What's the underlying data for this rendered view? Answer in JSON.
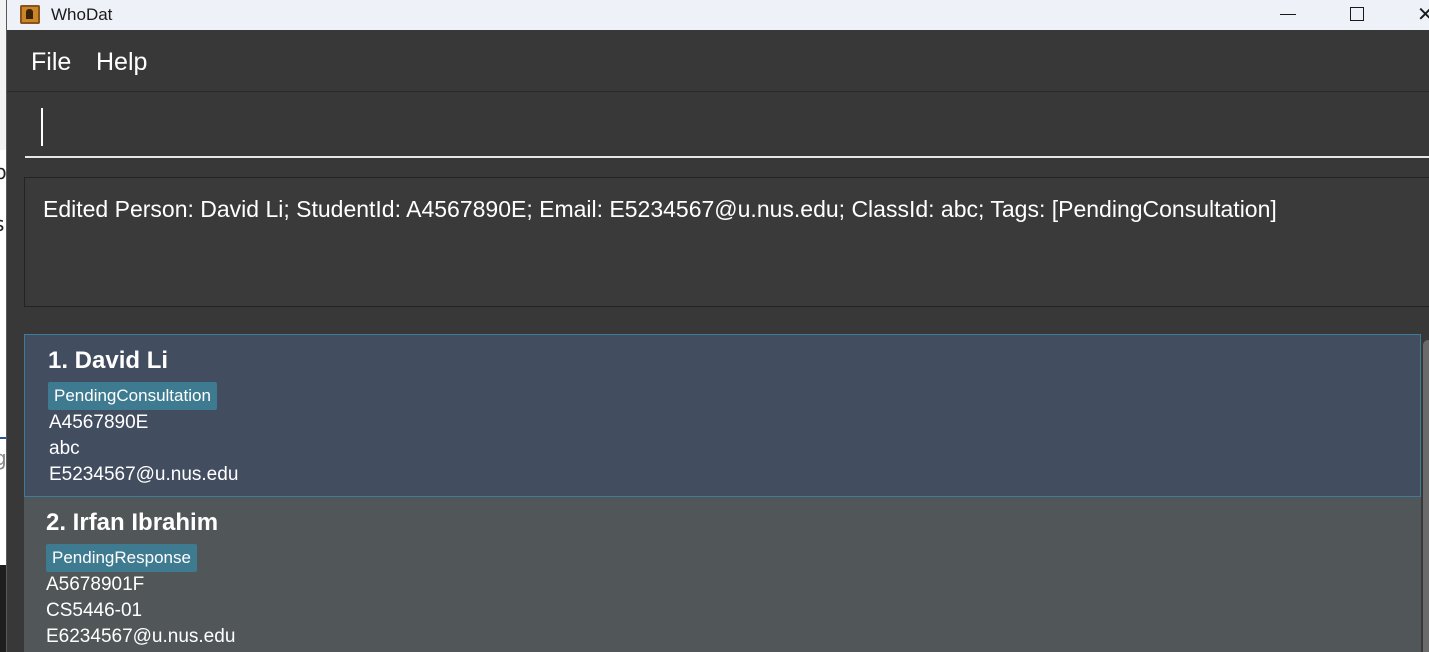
{
  "window": {
    "title": "WhoDat"
  },
  "menu": {
    "file_label": "File",
    "help_label": "Help"
  },
  "command": {
    "value": ""
  },
  "result": {
    "message": "Edited Person: David Li; StudentId: A4567890E; Email: E5234567@u.nus.edu; ClassId: abc; Tags: [PendingConsultation]"
  },
  "persons": [
    {
      "name": "1. David Li",
      "tag": "PendingConsultation",
      "student_id": "A4567890E",
      "class_id": "abc",
      "email": "E5234567@u.nus.edu",
      "selected": true
    },
    {
      "name": "2. Irfan Ibrahim",
      "tag": "PendingResponse",
      "student_id": "A5678901F",
      "class_id": "CS5446-01",
      "email": "E6234567@u.nus.edu",
      "selected": false
    }
  ],
  "colors": {
    "window_bg": "#383838",
    "selected_card_bg": "#424d5f",
    "card_bg": "#515658",
    "tag_bg": "#3e7b91",
    "text": "#ffffff"
  },
  "icons": {
    "app": "address-book-icon",
    "minimize": "minimize-icon",
    "maximize": "maximize-icon",
    "close": "close-icon"
  },
  "desktop_fragments": {
    "glyph_1": "b",
    "glyph_2": "l",
    "glyph_3": "s",
    "glyph_4": "g"
  }
}
